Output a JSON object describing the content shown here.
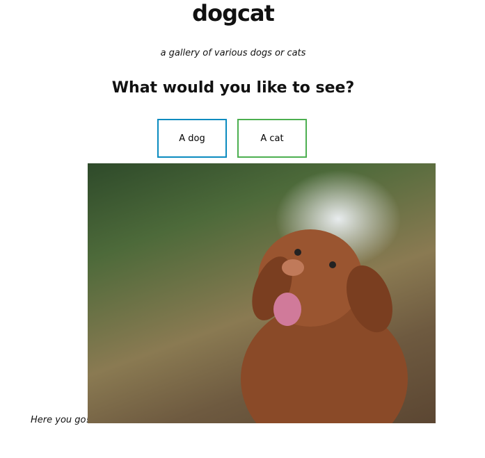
{
  "title": "dogcat",
  "subtitle": "a gallery of various dogs or cats",
  "question": "What would you like to see?",
  "buttons": {
    "dog": "A dog",
    "cat": "A cat"
  },
  "result_text": "Here you go!",
  "colors": {
    "dog_border": "#0a8bbf",
    "cat_border": "#4caf50"
  }
}
